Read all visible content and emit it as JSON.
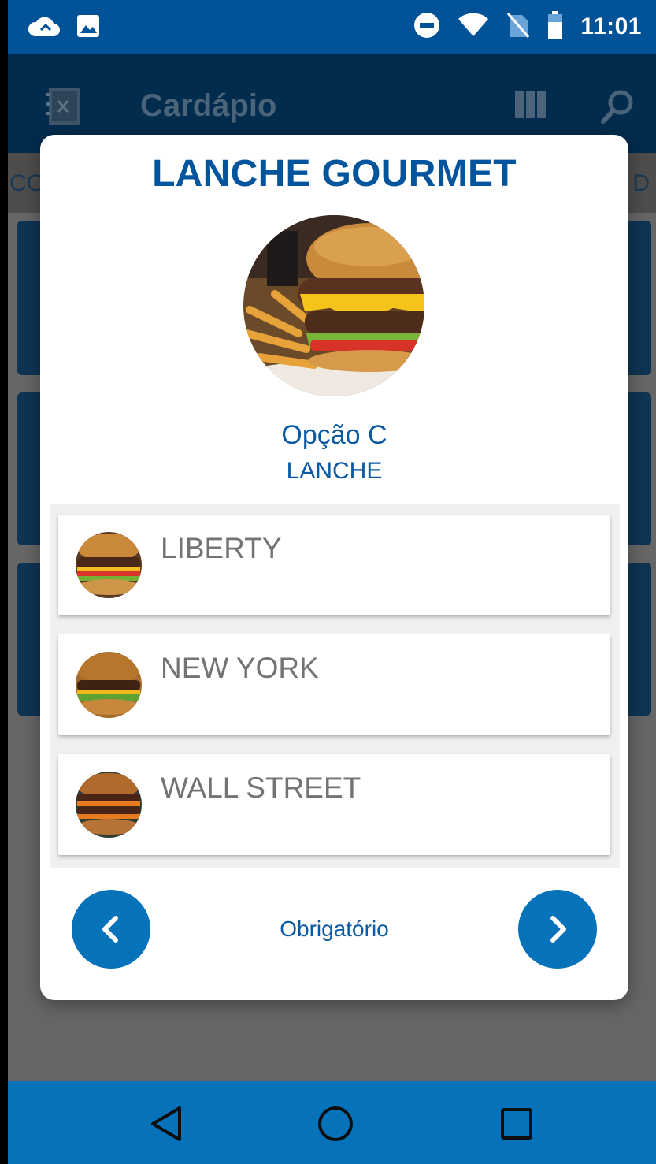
{
  "status_bar": {
    "time": "11:01",
    "icons_left": [
      "cloud-icon",
      "image-icon"
    ],
    "icons_right": [
      "do-not-disturb-icon",
      "wifi-icon",
      "no-sim-icon",
      "battery-icon"
    ]
  },
  "app_bar": {
    "title": "Cardápio",
    "icons": [
      "menu-book-icon",
      "view-columns-icon",
      "search-icon"
    ]
  },
  "tabs": {
    "left_partial": "CO",
    "right_partial": "M D"
  },
  "dialog": {
    "title": "LANCHE GOURMET",
    "subtitle": "Opção C",
    "category": "LANCHE",
    "options": [
      {
        "label": "LIBERTY",
        "icon": "burger-thumbnail"
      },
      {
        "label": "NEW YORK",
        "icon": "burger-thumbnail"
      },
      {
        "label": "WALL STREET",
        "icon": "burger-thumbnail"
      }
    ],
    "footer": {
      "label": "Obrigatório",
      "prev_icon": "chevron-left-icon",
      "next_icon": "chevron-right-icon"
    }
  },
  "nav_bar": {
    "buttons": [
      "back-icon",
      "home-icon",
      "recents-icon"
    ]
  },
  "colors": {
    "primary": "#0672b9",
    "primary_dark": "#025298",
    "title_blue": "#02549c",
    "option_text": "#737373"
  }
}
